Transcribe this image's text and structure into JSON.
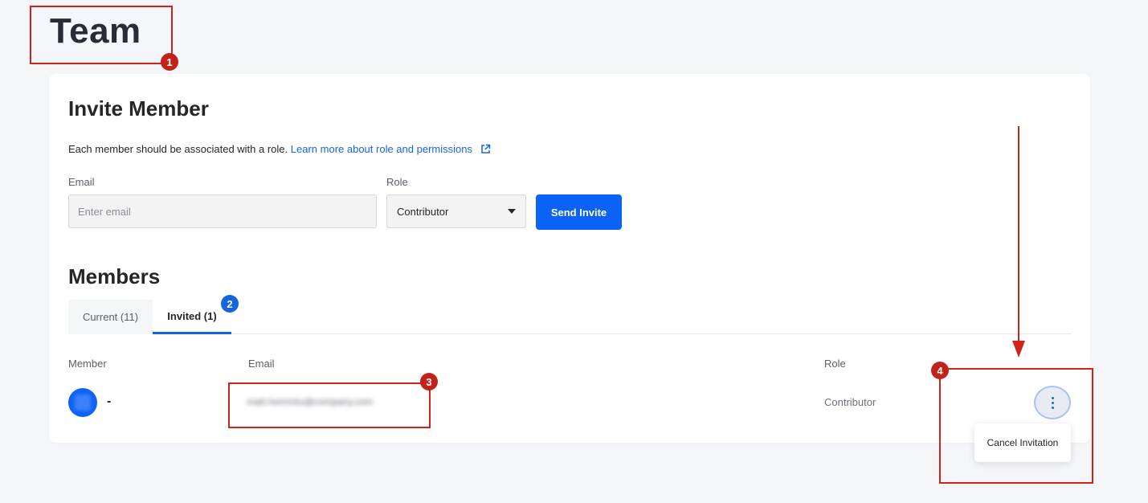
{
  "page": {
    "title": "Team"
  },
  "invite": {
    "title": "Invite Member",
    "description": "Each member should be associated with a role.",
    "learn_more_link": "Learn more about role and permissions",
    "email_label": "Email",
    "email_placeholder": "Enter email",
    "role_label": "Role",
    "role_value": "Contributor",
    "send_button": "Send Invite"
  },
  "members": {
    "title": "Members",
    "tabs": [
      {
        "label": "Current (11)",
        "active": false
      },
      {
        "label": "Invited (1)",
        "active": true
      }
    ],
    "columns": {
      "member": "Member",
      "email": "Email",
      "role": "Role"
    },
    "rows": [
      {
        "name": "-",
        "email": "matt.henricks@company.com",
        "role": "Contributor"
      }
    ],
    "row_menu": {
      "cancel_label": "Cancel Invitation"
    }
  },
  "annotations": [
    {
      "label": "1",
      "color": "#c1221a"
    },
    {
      "label": "2",
      "color": "#1565e0"
    },
    {
      "label": "3",
      "color": "#c1221a"
    },
    {
      "label": "4",
      "color": "#c1221a"
    }
  ],
  "colors": {
    "primary": "#0b63f6",
    "link": "#1565e0",
    "annotation": "#d0241b"
  }
}
